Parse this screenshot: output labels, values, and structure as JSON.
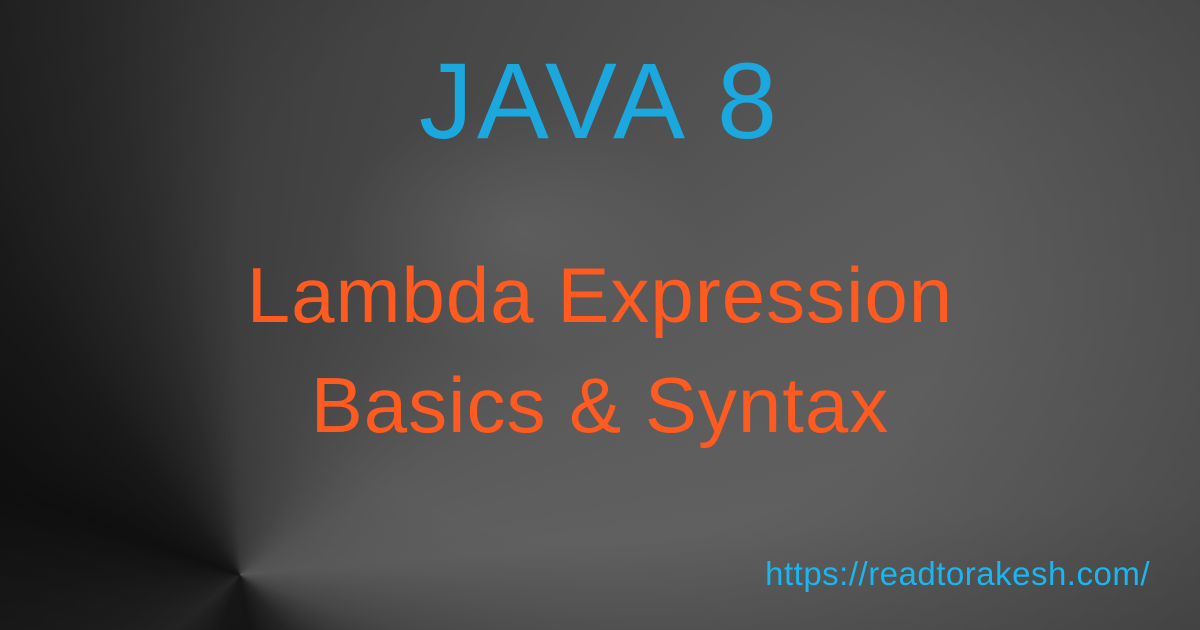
{
  "banner": {
    "title": "JAVA 8",
    "subtitle_line1": "Lambda Expression",
    "subtitle_line2": "Basics & Syntax",
    "url": "https://readtorakesh.com/"
  },
  "colors": {
    "title": "#1aa8df",
    "subtitle": "#ff5a1f",
    "url": "#19b6ef",
    "background": "#3a3a3a"
  }
}
